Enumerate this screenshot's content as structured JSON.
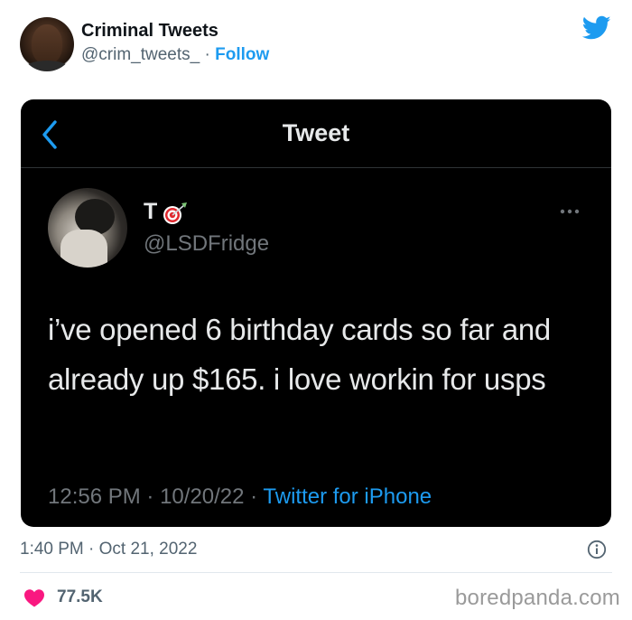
{
  "author": {
    "display_name": "Criminal Tweets",
    "handle": "@crim_tweets_",
    "separator": "·",
    "follow_label": "Follow"
  },
  "screenshot": {
    "title": "Tweet",
    "user": {
      "name": "T",
      "emoji_icon": "target-dart-icon",
      "handle": "@LSDFridge"
    },
    "text": "i’ve opened 6 birthday cards so far and already up $165. i love workin for usps",
    "time": "12:56 PM",
    "date": "10/20/22",
    "separator": "·",
    "source": "Twitter for iPhone"
  },
  "footer": {
    "timestamp": "1:40 PM · Oct 21, 2022",
    "likes": "77.5K"
  },
  "watermark": "boredpanda.com",
  "colors": {
    "twitter_blue": "#1d9bf0",
    "like_red": "#f91880",
    "dark_bg": "#000000"
  }
}
